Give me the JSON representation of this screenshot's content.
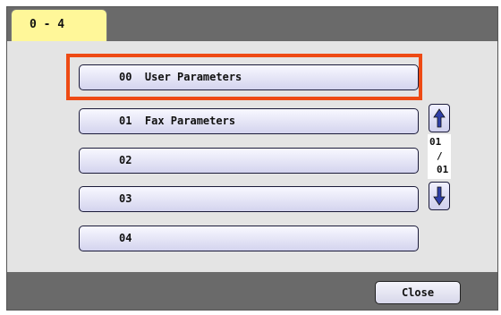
{
  "tab": {
    "label": "0 - 4"
  },
  "menu_items": [
    {
      "label": "00  User Parameters",
      "selected": true
    },
    {
      "label": "01  Fax Parameters",
      "selected": false
    },
    {
      "label": "02",
      "selected": false
    },
    {
      "label": "03",
      "selected": false
    },
    {
      "label": "04",
      "selected": false
    }
  ],
  "pager": {
    "current": "01",
    "separator": "/",
    "total": "01"
  },
  "footer": {
    "close_label": "Close"
  },
  "colors": {
    "selection_border": "#ee4a14",
    "tab_background": "#fff799",
    "bar_background": "#6a6a6a",
    "arrow_color": "#2f3fa8"
  },
  "icons": {
    "scroll_up": "arrow-up-icon",
    "scroll_down": "arrow-down-icon"
  }
}
